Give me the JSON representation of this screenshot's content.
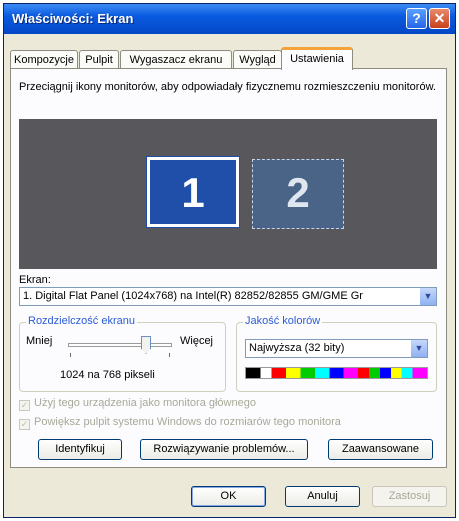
{
  "window": {
    "title": "Właściwości: Ekran",
    "help_button": "?",
    "close_button": "✕"
  },
  "tabs": [
    {
      "label": "Kompozycje"
    },
    {
      "label": "Pulpit"
    },
    {
      "label": "Wygaszacz ekranu"
    },
    {
      "label": "Wygląd"
    },
    {
      "label": "Ustawienia",
      "active": true
    }
  ],
  "settings": {
    "instruction": "Przeciągnij ikony monitorów, aby odpowiadały fizycznemu rozmieszczeniu monitorów.",
    "monitors": [
      "1",
      "2"
    ],
    "display_label": "Ekran:",
    "display_value": "1. Digital Flat Panel (1024x768) na Intel(R) 82852/82855 GM/GME Gr",
    "resolution": {
      "title": "Rozdzielczość ekranu",
      "less_label": "Mniej",
      "more_label": "Więcej",
      "value_text": "1024 na 768 pikseli",
      "slider_level": 0.75
    },
    "color_quality": {
      "title": "Jakość kolorów",
      "selected": "Najwyższa (32 bity)"
    },
    "checkbox_primary": "Użyj tego urządzenia jako monitora głównego",
    "checkbox_extend": "Powiększ pulpit systemu Windows do rozmiarów tego monitora",
    "buttons": {
      "identify": "Identyfikuj",
      "troubleshoot": "Rozwiązywanie problemów...",
      "advanced": "Zaawansowane"
    }
  },
  "footer": {
    "ok": "OK",
    "cancel": "Anuluj",
    "apply": "Zastosuj"
  },
  "colors": {
    "titlebar": "#0a5be0",
    "active_tab_accent": "#f3a33a",
    "group_title": "#2a5bd7",
    "monitor_selected": "#1f4fa8"
  }
}
